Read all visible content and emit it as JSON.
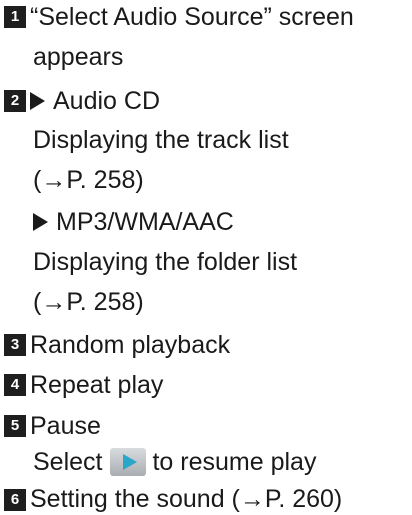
{
  "steps": [
    {
      "number": "1",
      "lines": [
        "“Select Audio Source” screen",
        "appears"
      ]
    },
    {
      "number": "2",
      "sources": [
        {
          "label": "Audio CD",
          "lines": [
            "Displaying the track list",
            "(→P. 258)"
          ]
        },
        {
          "label": "MP3/WMA/AAC",
          "lines": [
            "Displaying the folder list",
            "(→P. 258)"
          ]
        }
      ]
    },
    {
      "number": "3",
      "lines": [
        "Random playback"
      ]
    },
    {
      "number": "4",
      "lines": [
        "Repeat play"
      ]
    },
    {
      "number": "5",
      "lines": [
        "Pause"
      ],
      "resume": {
        "before": "Select",
        "after": "to resume play",
        "icon": "play-icon"
      }
    },
    {
      "number": "6",
      "lines": [
        "Setting the sound (→P. 260)"
      ]
    }
  ],
  "colors": {
    "badge": "#1e1e1e",
    "play_icon": "#2aa6c8"
  }
}
